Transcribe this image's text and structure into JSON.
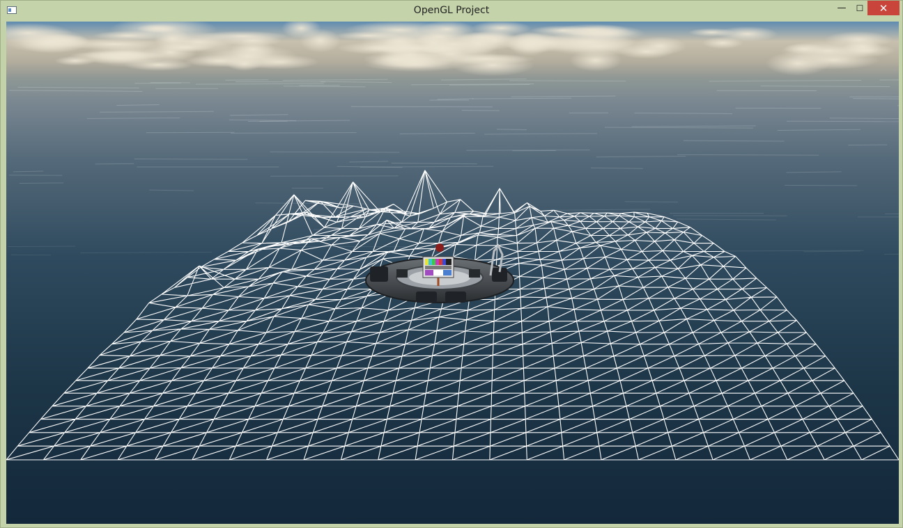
{
  "window": {
    "title": "OpenGL Project",
    "controls": {
      "minimize_glyph": "—",
      "maximize_glyph": "☐",
      "close_glyph": "✕"
    }
  },
  "icons": {
    "app": "app-window-icon",
    "minimize": "minimize-icon",
    "maximize": "maximize-icon",
    "close": "close-icon"
  },
  "colors": {
    "titlebar": "#c4d3aa",
    "close_button": "#c9443b",
    "sea_far": "#7c8a95",
    "sea_near": "#14293a",
    "wireframe": "#ffffff"
  }
}
